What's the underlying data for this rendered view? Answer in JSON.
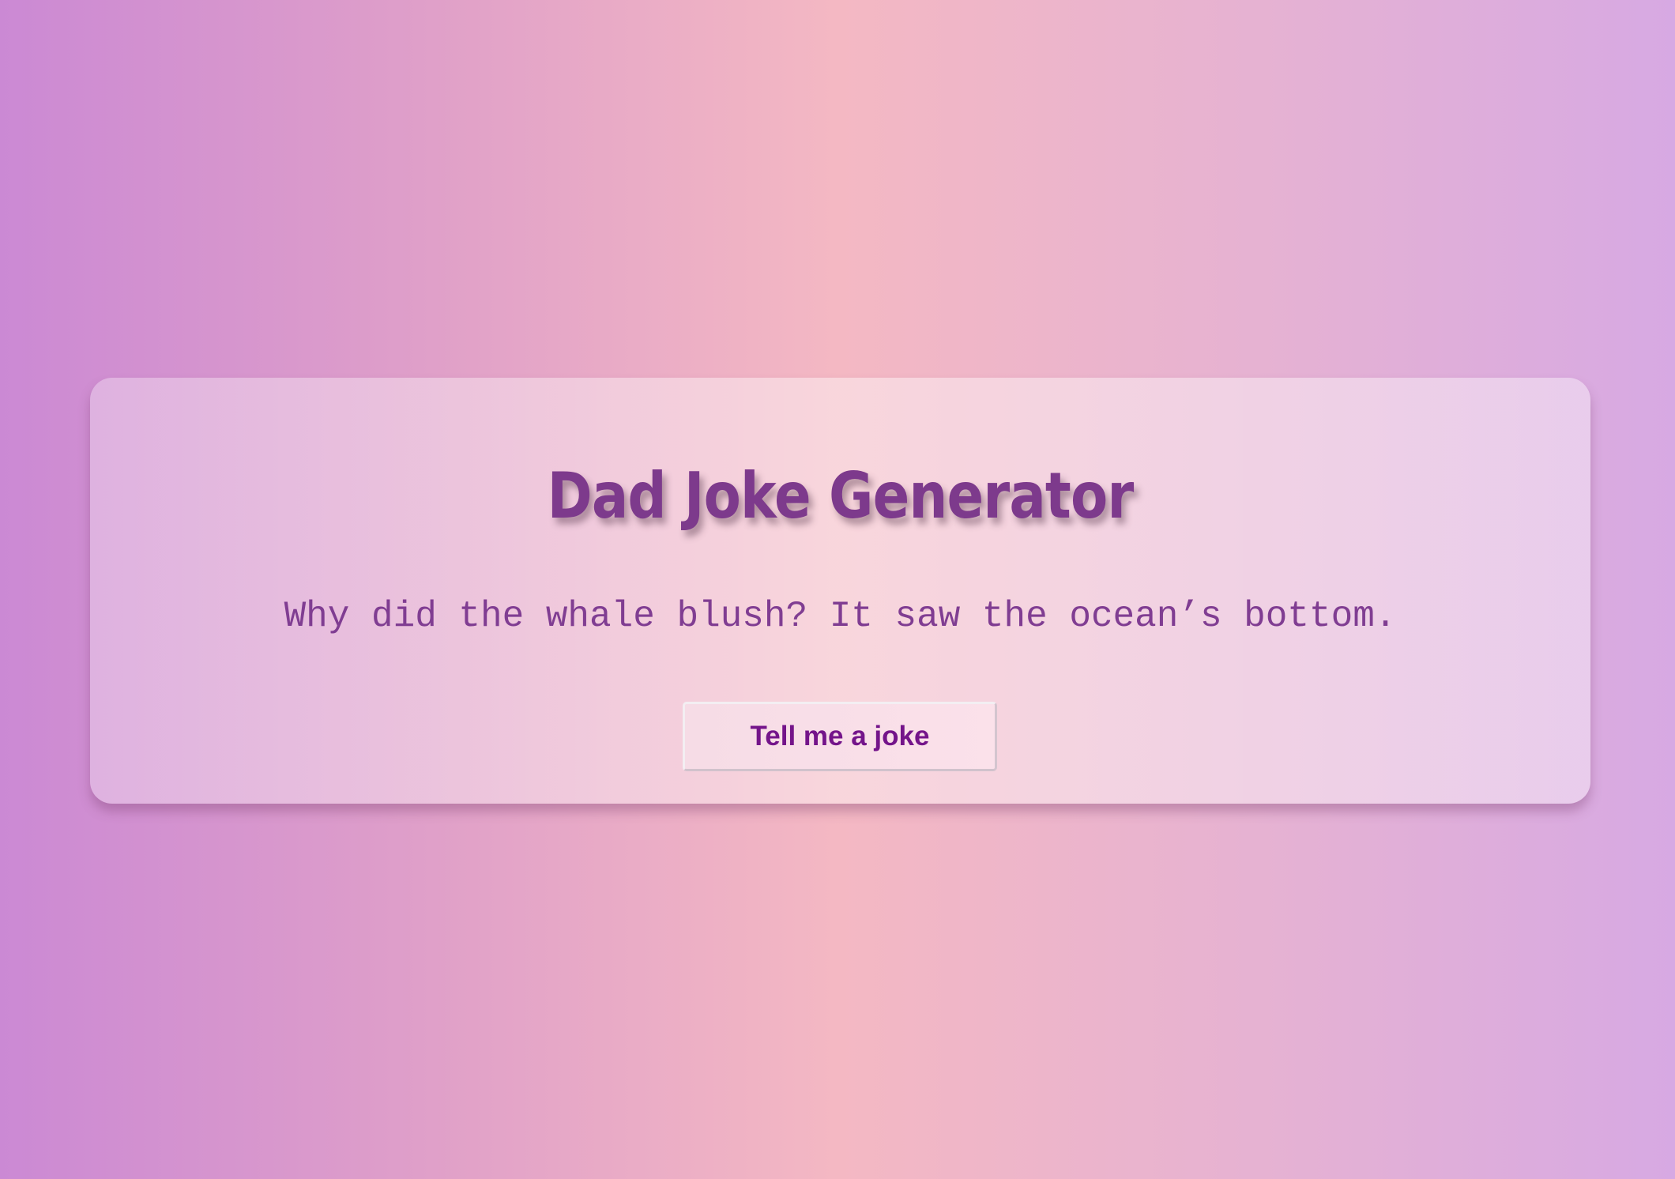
{
  "app": {
    "title": "Dad Joke Generator",
    "joke": "Why did the whale blush? It saw the ocean’s bottom.",
    "button_label": "Tell me a joke"
  },
  "colors": {
    "title": "#7d3a8c",
    "joke_text": "#803d92",
    "button_text": "#74148a",
    "background_left": "#cb89d4",
    "background_center": "#f4b8c3",
    "background_right": "#d7a9e3"
  }
}
